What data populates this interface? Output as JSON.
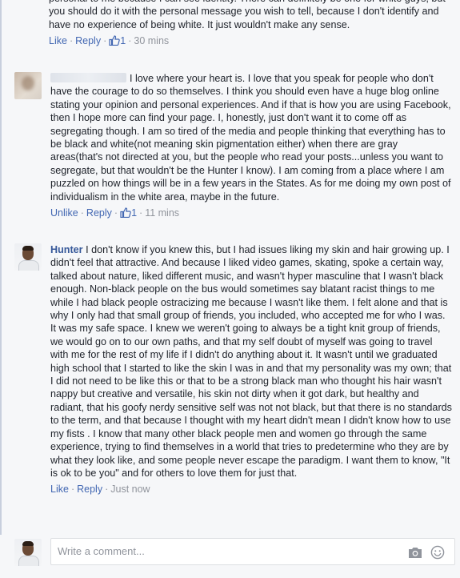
{
  "comments": [
    {
      "text": "personal to me because I can see identity. There can definitely be one for white guys, but you should do it with the personal message you wish to tell, because I don't identify and have no experience of being white. It just wouldn't make any sense.",
      "actions": {
        "like": "Like",
        "reply": "Reply",
        "likes": "1",
        "time": "30 mins"
      }
    },
    {
      "text": "I love where your heart is. I love that you speak for people who don't have the courage to do so themselves. I think you should even have a huge blog online stating your opinion and personal experiences. And if that is how you are using Facebook, then I hope more can find your page. I, honestly, just don't want it to come off as segregating though. I am so tired of the media and people thinking that everything has to be black and white(not meaning skin pigmentation either) when there are gray areas(that's not directed at you, but the people who read your posts...unless you want to segregate, but that wouldn't be the Hunter I know). I am coming from a place where I am puzzled on how things will be in a few years in the States. As for me doing my own post of individualism in the white area, maybe in the future.",
      "actions": {
        "like": "Unlike",
        "reply": "Reply",
        "likes": "1",
        "time": "11 mins"
      }
    },
    {
      "author": "Hunter",
      "text": "I don't know if you knew this, but I had issues liking my skin and hair growing up. I didn't feel that attractive. And because I liked video games, skating, spoke a certain way, talked about nature, liked different music, and wasn't hyper masculine that I wasn't black enough. Non-black people on the bus would sometimes say blatant racist things to me while I had black people ostracizing me because I wasn't like them. I felt alone and that is why I only had that small group of friends, you included, who accepted me for who I was. It was my safe space. I knew we weren't going to always be a tight knit group of friends, we would go on to our own paths, and that my self doubt of myself was going to travel with me for the rest of my life if I didn't do anything about it. It wasn't until we graduated high school that I started to like the skin I was in and that my personality was my own; that I did not need to be like this or that to be a strong black man who thought his hair wasn't nappy but creative and versatile, his skin not dirty when it got dark, but healthy and radiant, that his goofy nerdy sensitive self was not not black, but that there is no standards to the term, and that because I thought with my heart didn't mean I didn't know how to use my fists . I know that many other black people men and women go through the same experience, trying to find themselves in a world that tries to predetermine who they are by what they look like, and some people never escape the paradigm. I want them to know, \"It is ok to be you\" and for others to love them for just that.",
      "actions": {
        "like": "Like",
        "reply": "Reply",
        "time": "Just now"
      }
    }
  ],
  "composer": {
    "placeholder": "Write a comment..."
  },
  "icons": {
    "like": "thumbs-up-icon",
    "camera": "camera-icon",
    "emoji": "smiley-icon"
  },
  "colors": {
    "link": "#4267b2",
    "author": "#365899",
    "meta": "#90949c"
  }
}
